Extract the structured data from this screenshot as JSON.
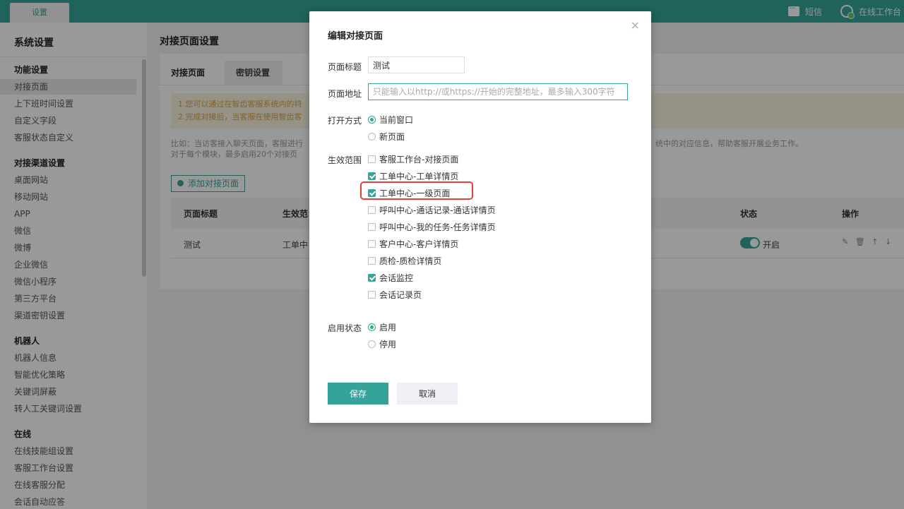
{
  "topbar": {
    "tab_label": "设置",
    "sms_label": "短信",
    "workspace_label": "在线工作台"
  },
  "sidebar": {
    "title": "系统设置",
    "groups": [
      {
        "title": "功能设置",
        "items": [
          "对接页面",
          "上下班时间设置",
          "自定义字段",
          "客服状态自定义"
        ]
      },
      {
        "title": "对接渠道设置",
        "items": [
          "桌面网站",
          "移动网站",
          "APP",
          "微信",
          "微博",
          "企业微信",
          "微信小程序",
          "第三方平台",
          "渠道密钥设置"
        ]
      },
      {
        "title": "机器人",
        "items": [
          "机器人信息",
          "智能优化策略",
          "关键词屏蔽",
          "转人工关键词设置"
        ]
      },
      {
        "title": "在线",
        "items": [
          "在线技能组设置",
          "客服工作台设置",
          "在线客服分配",
          "会话自动应答"
        ]
      }
    ]
  },
  "main": {
    "title": "对接页面设置",
    "tabs": [
      "对接页面",
      "密钥设置"
    ],
    "notice_line1": "1.您可以通过在智齿客服系统内的特",
    "notice_line2": "2.完成对接后，当客服在使用智齿客",
    "desc_line1": "比如：当访客接入聊天页面，客服进行",
    "desc_line1_tail": "统中的对应信息，帮助客服开展业务工作。",
    "desc_line2": "对于每个模块，最多启用20个对接页",
    "add_button": "添加对接页面",
    "table": {
      "headers": [
        "页面标题",
        "生效范",
        "状态",
        "操作"
      ],
      "row": {
        "title": "测试",
        "scope": "工单中",
        "status": "开启",
        "ops": "✎ 🗑 ↑ ↓"
      }
    }
  },
  "modal": {
    "title": "编辑对接页面",
    "close": "×",
    "page_title_label": "页面标题",
    "page_title_value": "测试",
    "page_url_label": "页面地址",
    "page_url_placeholder": "只能输入以http://或https://开始的完整地址，最多输入300字符",
    "open_mode_label": "打开方式",
    "open_mode_options": [
      {
        "label": "当前窗口",
        "checked": true
      },
      {
        "label": "新页面",
        "checked": false
      }
    ],
    "scope_label": "生效范围",
    "scope_options": [
      {
        "label": "客服工作台-对接页面",
        "checked": false
      },
      {
        "label": "工单中心-工单详情页",
        "checked": true
      },
      {
        "label": "工单中心-一级页面",
        "checked": true
      },
      {
        "label": "呼叫中心-通话记录-通话详情页",
        "checked": false
      },
      {
        "label": "呼叫中心-我的任务-任务详情页",
        "checked": false
      },
      {
        "label": "客户中心-客户详情页",
        "checked": false
      },
      {
        "label": "质检-质检详情页",
        "checked": false
      },
      {
        "label": "会话监控",
        "checked": true
      },
      {
        "label": "会话记录页",
        "checked": false
      }
    ],
    "enable_label": "启用状态",
    "enable_options": [
      {
        "label": "启用",
        "checked": true
      },
      {
        "label": "停用",
        "checked": false
      }
    ],
    "save_button": "保存",
    "cancel_button": "取消"
  },
  "colors": {
    "accent": "#36a39a",
    "highlight": "#e0423a",
    "notice_bg": "#fbf3e0"
  }
}
